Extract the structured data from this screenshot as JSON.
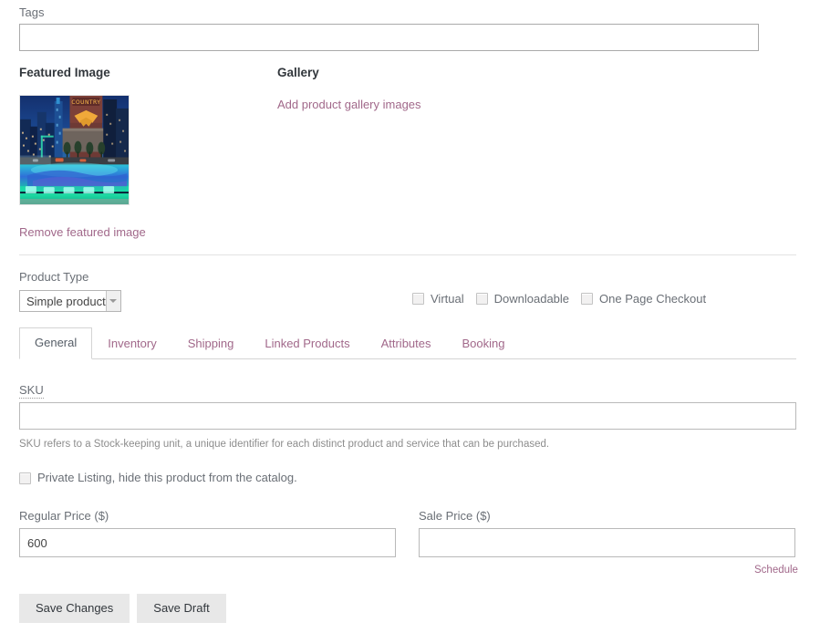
{
  "tags": {
    "label": "Tags",
    "value": "",
    "placeholder": ""
  },
  "featured_image": {
    "heading": "Featured Image",
    "alt": "Night cityscape with rooftop swimming pool",
    "remove_label": "Remove featured image"
  },
  "gallery": {
    "heading": "Gallery",
    "add_link": "Add product gallery images"
  },
  "product_type": {
    "label": "Product Type",
    "selected": "Simple product",
    "options": [
      "Simple product"
    ]
  },
  "type_toggles": [
    {
      "label": "Virtual",
      "checked": false
    },
    {
      "label": "Downloadable",
      "checked": false
    },
    {
      "label": "One Page Checkout",
      "checked": false
    }
  ],
  "tabs": [
    {
      "label": "General",
      "active": true
    },
    {
      "label": "Inventory",
      "active": false
    },
    {
      "label": "Shipping",
      "active": false
    },
    {
      "label": "Linked Products",
      "active": false
    },
    {
      "label": "Attributes",
      "active": false
    },
    {
      "label": "Booking",
      "active": false
    }
  ],
  "sku": {
    "label": "SKU",
    "value": "",
    "placeholder": "",
    "help": "SKU refers to a Stock-keeping unit, a unique identifier for each distinct product and service that can be purchased."
  },
  "private_listing": {
    "label": "Private Listing, hide this product from the catalog.",
    "checked": false
  },
  "regular_price": {
    "label": "Regular Price ($)",
    "value": "600",
    "placeholder": ""
  },
  "sale_price": {
    "label": "Sale Price ($)",
    "value": "",
    "placeholder": "",
    "schedule_label": "Schedule"
  },
  "actions": {
    "save_changes": "Save Changes",
    "save_draft": "Save Draft"
  },
  "colors": {
    "link": "#a1688a",
    "label": "#6a6f76",
    "heading": "#32373c",
    "border": "#aaaaaa",
    "button_bg": "#e8e8e8"
  }
}
